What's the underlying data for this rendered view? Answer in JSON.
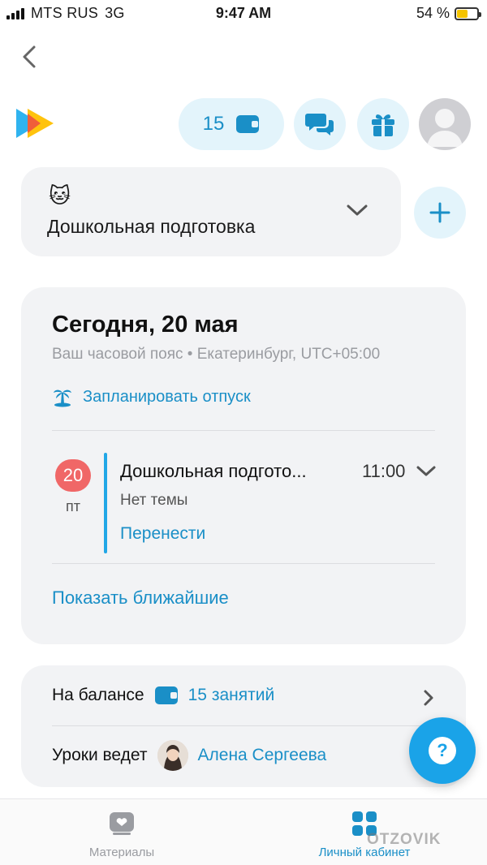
{
  "status_bar": {
    "carrier": "MTS RUS",
    "network": "3G",
    "time": "9:47 AM",
    "battery": "54 %",
    "battery_level": 0.54
  },
  "header": {
    "balance_count": "15"
  },
  "course": {
    "emoji": "🐱",
    "title": "Дошкольная подготовка"
  },
  "schedule": {
    "date": "Сегодня, 20 мая",
    "timezone": "Ваш часовой пояс • Екатеринбург, UTC+05:00",
    "vacation_link": "Запланировать отпуск",
    "lesson": {
      "day": "20",
      "weekday": "пт",
      "title": "Дошкольная подгото...",
      "time": "11:00",
      "topic": "Нет темы",
      "reschedule": "Перенести"
    },
    "show_upcoming": "Показать ближайшие"
  },
  "info": {
    "balance_label": "На балансе",
    "balance_value": "15 занятий",
    "teacher_label": "Уроки ведет",
    "teacher_name": "Алена Сергеева"
  },
  "help": {
    "symbol": "?"
  },
  "tabs": [
    {
      "label": "Материалы",
      "icon": "materials-icon"
    },
    {
      "label": "Личный кабинет",
      "icon": "grid-icon"
    }
  ],
  "watermark": "OTZOVIK",
  "colors": {
    "accent": "#1a8fc7",
    "help_button": "#1aa3e8",
    "badge": "#f06767",
    "card_bg": "#f2f3f5"
  }
}
